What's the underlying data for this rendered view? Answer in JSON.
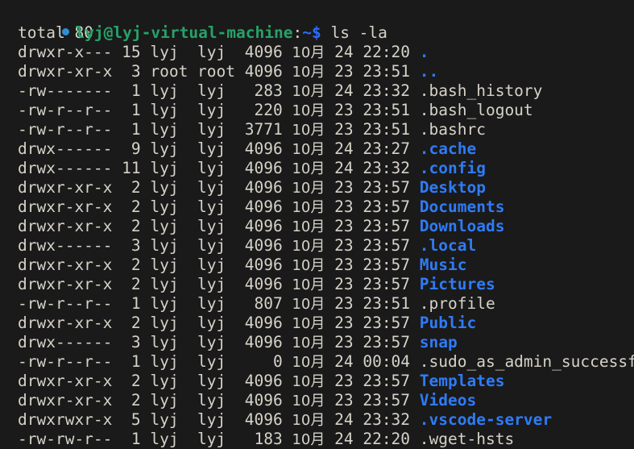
{
  "window": {
    "title": "lyj@lyj-virtual-machine: ~",
    "background_color": "#1a1a1a",
    "foreground_color": "#d6d2c8",
    "directory_color": "#2f7bf6",
    "prompt_user_color": "#26a269",
    "prompt_dot_color": "#2e8fd4"
  },
  "clipped_top_line": "                                                     ",
  "prompt": {
    "dot": "status-dot",
    "user_host": "lyj@lyj-virtual-machine",
    "colon": ":",
    "cwd": "~$",
    "command": " ls -la"
  },
  "output": {
    "total_line": "total 80",
    "rows": [
      {
        "perms": "drwxr-x---",
        "links": "15",
        "owner": "lyj",
        "group": "lyj",
        "size": "4096",
        "month": "10月",
        "day": "24",
        "time": "22:20",
        "name": ".",
        "type": "dir"
      },
      {
        "perms": "drwxr-xr-x",
        "links": "3",
        "owner": "root",
        "group": "root",
        "size": "4096",
        "month": "10月",
        "day": "23",
        "time": "23:51",
        "name": "..",
        "type": "dir"
      },
      {
        "perms": "-rw-------",
        "links": "1",
        "owner": "lyj",
        "group": "lyj",
        "size": "283",
        "month": "10月",
        "day": "24",
        "time": "23:32",
        "name": ".bash_history",
        "type": "file"
      },
      {
        "perms": "-rw-r--r--",
        "links": "1",
        "owner": "lyj",
        "group": "lyj",
        "size": "220",
        "month": "10月",
        "day": "23",
        "time": "23:51",
        "name": ".bash_logout",
        "type": "file"
      },
      {
        "perms": "-rw-r--r--",
        "links": "1",
        "owner": "lyj",
        "group": "lyj",
        "size": "3771",
        "month": "10月",
        "day": "23",
        "time": "23:51",
        "name": ".bashrc",
        "type": "file"
      },
      {
        "perms": "drwx------",
        "links": "9",
        "owner": "lyj",
        "group": "lyj",
        "size": "4096",
        "month": "10月",
        "day": "24",
        "time": "23:27",
        "name": ".cache",
        "type": "dir"
      },
      {
        "perms": "drwx------",
        "links": "11",
        "owner": "lyj",
        "group": "lyj",
        "size": "4096",
        "month": "10月",
        "day": "24",
        "time": "23:32",
        "name": ".config",
        "type": "dir"
      },
      {
        "perms": "drwxr-xr-x",
        "links": "2",
        "owner": "lyj",
        "group": "lyj",
        "size": "4096",
        "month": "10月",
        "day": "23",
        "time": "23:57",
        "name": "Desktop",
        "type": "dir"
      },
      {
        "perms": "drwxr-xr-x",
        "links": "2",
        "owner": "lyj",
        "group": "lyj",
        "size": "4096",
        "month": "10月",
        "day": "23",
        "time": "23:57",
        "name": "Documents",
        "type": "dir"
      },
      {
        "perms": "drwxr-xr-x",
        "links": "2",
        "owner": "lyj",
        "group": "lyj",
        "size": "4096",
        "month": "10月",
        "day": "23",
        "time": "23:57",
        "name": "Downloads",
        "type": "dir"
      },
      {
        "perms": "drwx------",
        "links": "3",
        "owner": "lyj",
        "group": "lyj",
        "size": "4096",
        "month": "10月",
        "day": "23",
        "time": "23:57",
        "name": ".local",
        "type": "dir"
      },
      {
        "perms": "drwxr-xr-x",
        "links": "2",
        "owner": "lyj",
        "group": "lyj",
        "size": "4096",
        "month": "10月",
        "day": "23",
        "time": "23:57",
        "name": "Music",
        "type": "dir"
      },
      {
        "perms": "drwxr-xr-x",
        "links": "2",
        "owner": "lyj",
        "group": "lyj",
        "size": "4096",
        "month": "10月",
        "day": "23",
        "time": "23:57",
        "name": "Pictures",
        "type": "dir"
      },
      {
        "perms": "-rw-r--r--",
        "links": "1",
        "owner": "lyj",
        "group": "lyj",
        "size": "807",
        "month": "10月",
        "day": "23",
        "time": "23:51",
        "name": ".profile",
        "type": "file"
      },
      {
        "perms": "drwxr-xr-x",
        "links": "2",
        "owner": "lyj",
        "group": "lyj",
        "size": "4096",
        "month": "10月",
        "day": "23",
        "time": "23:57",
        "name": "Public",
        "type": "dir"
      },
      {
        "perms": "drwx------",
        "links": "3",
        "owner": "lyj",
        "group": "lyj",
        "size": "4096",
        "month": "10月",
        "day": "23",
        "time": "23:57",
        "name": "snap",
        "type": "dir"
      },
      {
        "perms": "-rw-r--r--",
        "links": "1",
        "owner": "lyj",
        "group": "lyj",
        "size": "0",
        "month": "10月",
        "day": "24",
        "time": "00:04",
        "name": ".sudo_as_admin_successful",
        "type": "file"
      },
      {
        "perms": "drwxr-xr-x",
        "links": "2",
        "owner": "lyj",
        "group": "lyj",
        "size": "4096",
        "month": "10月",
        "day": "23",
        "time": "23:57",
        "name": "Templates",
        "type": "dir"
      },
      {
        "perms": "drwxr-xr-x",
        "links": "2",
        "owner": "lyj",
        "group": "lyj",
        "size": "4096",
        "month": "10月",
        "day": "23",
        "time": "23:57",
        "name": "Videos",
        "type": "dir"
      },
      {
        "perms": "drwxrwxr-x",
        "links": "5",
        "owner": "lyj",
        "group": "lyj",
        "size": "4096",
        "month": "10月",
        "day": "24",
        "time": "23:32",
        "name": ".vscode-server",
        "type": "dir"
      },
      {
        "perms": "-rw-rw-r--",
        "links": "1",
        "owner": "lyj",
        "group": "lyj",
        "size": "183",
        "month": "10月",
        "day": "24",
        "time": "22:20",
        "name": ".wget-hsts",
        "type": "file"
      }
    ]
  }
}
